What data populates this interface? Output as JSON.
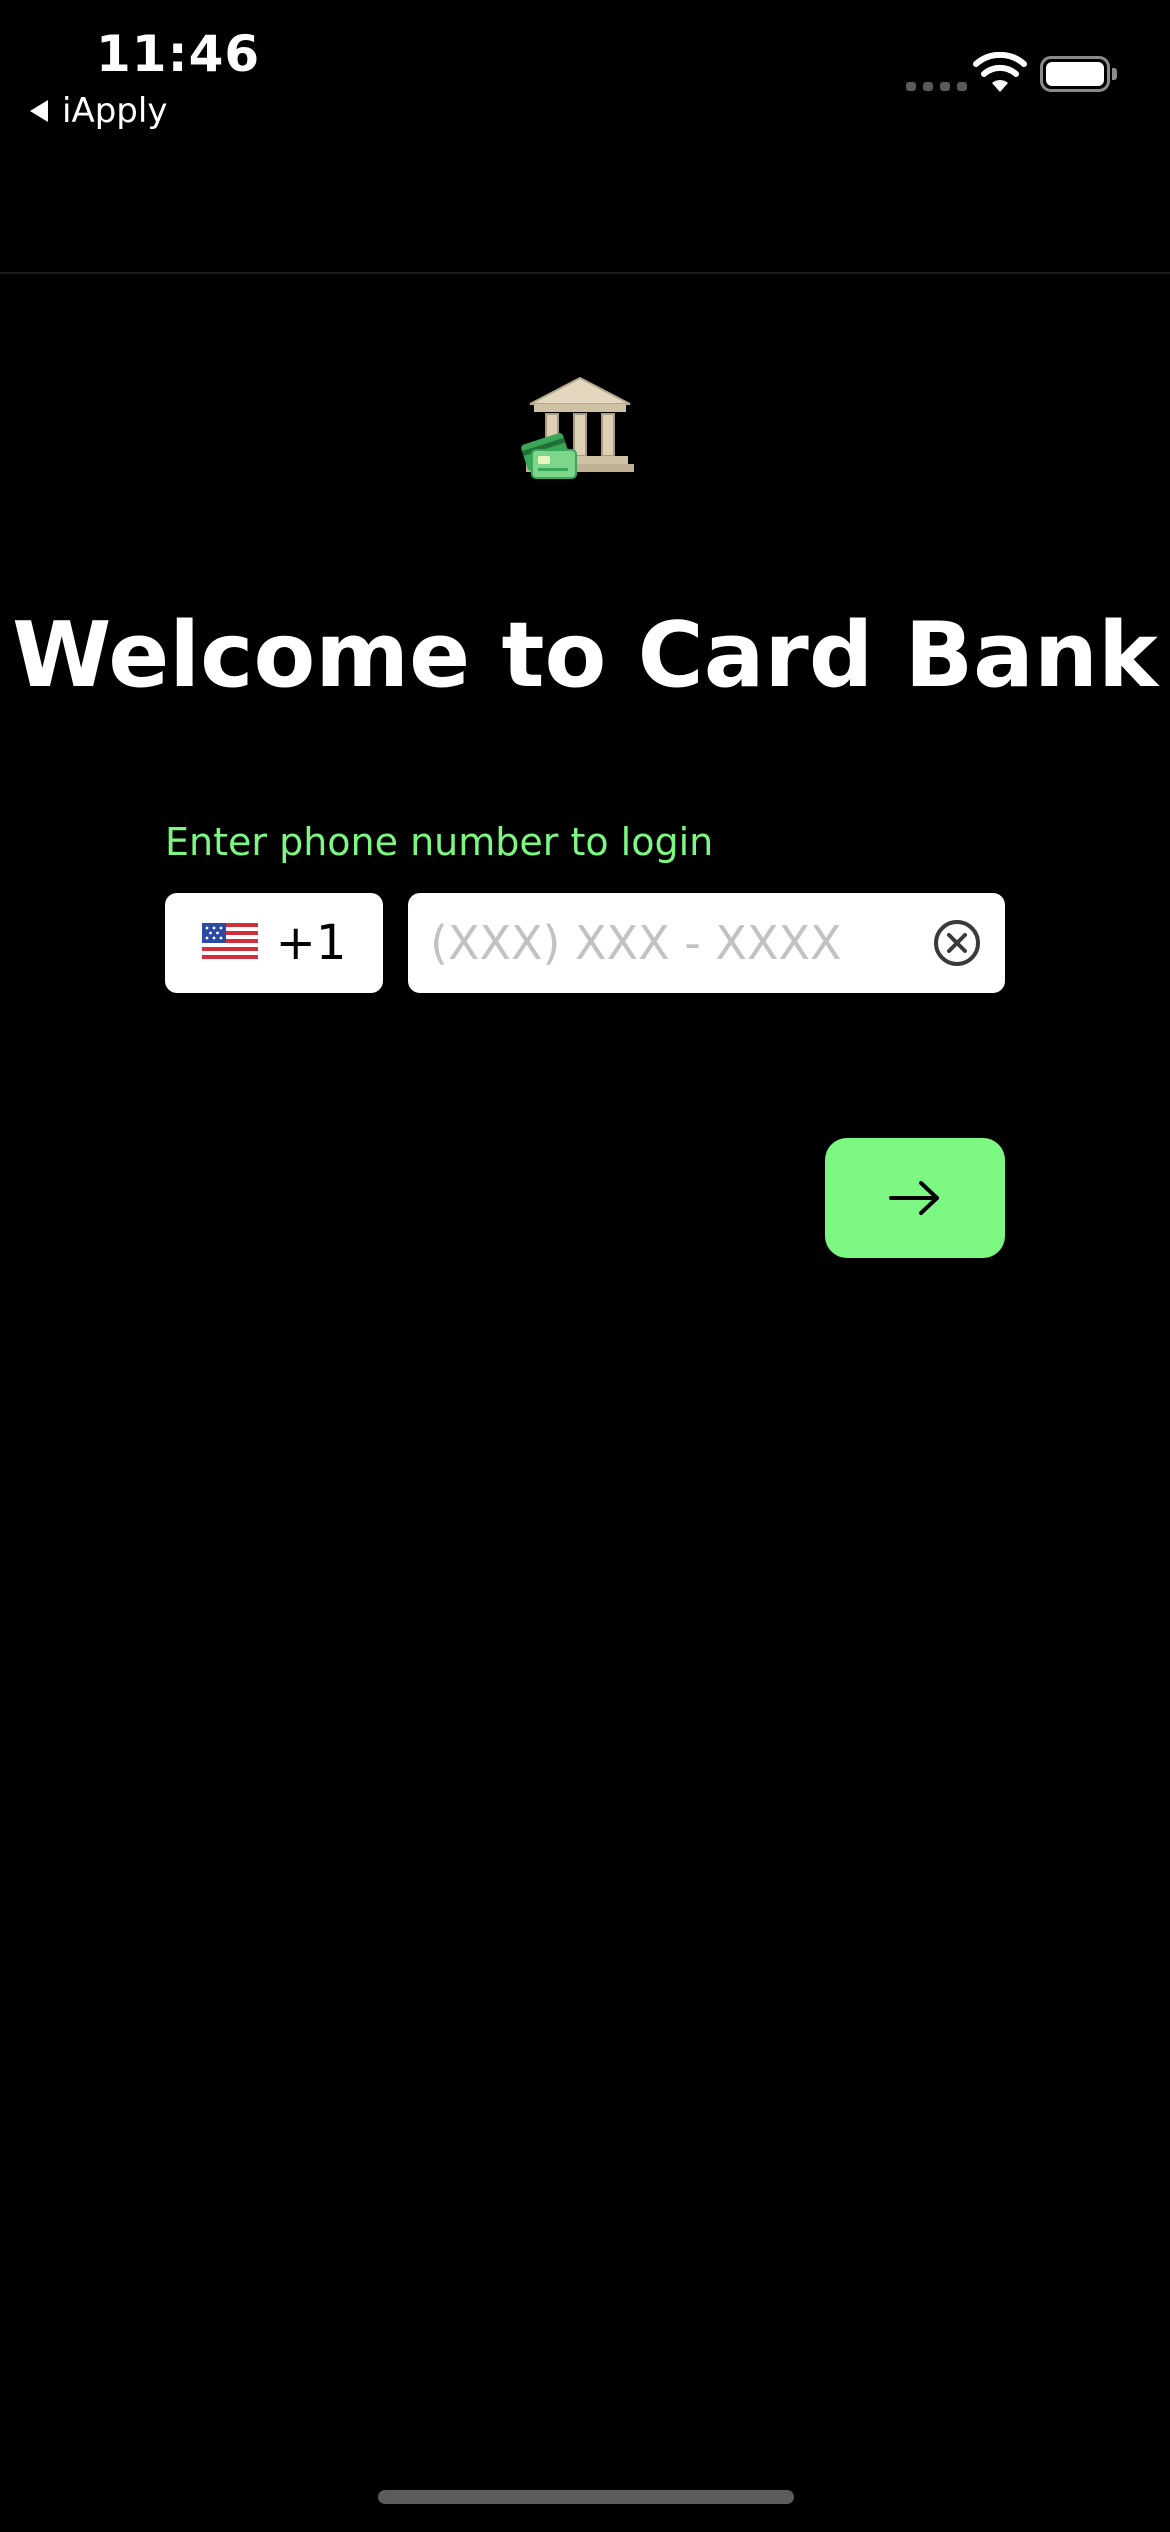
{
  "status_bar": {
    "time": "11:46",
    "back_app": "iApply",
    "icons": [
      "cellular-signal-icon",
      "wifi-icon",
      "battery-icon"
    ]
  },
  "logo": {
    "icon": "bank-with-cards-icon"
  },
  "header": {
    "title": "Welcome to Card Bank"
  },
  "login": {
    "label": "Enter phone number to login",
    "country_code": "+1",
    "flag_icon": "us-flag-icon",
    "phone_value": "",
    "phone_placeholder": "(XXX) XXX - XXXX",
    "clear_icon": "clear-circle-icon",
    "submit_icon": "arrow-right-icon"
  },
  "colors": {
    "background": "#000000",
    "accent": "#7cf782",
    "field_background": "#ffffff",
    "placeholder": "#c2c2c2"
  }
}
